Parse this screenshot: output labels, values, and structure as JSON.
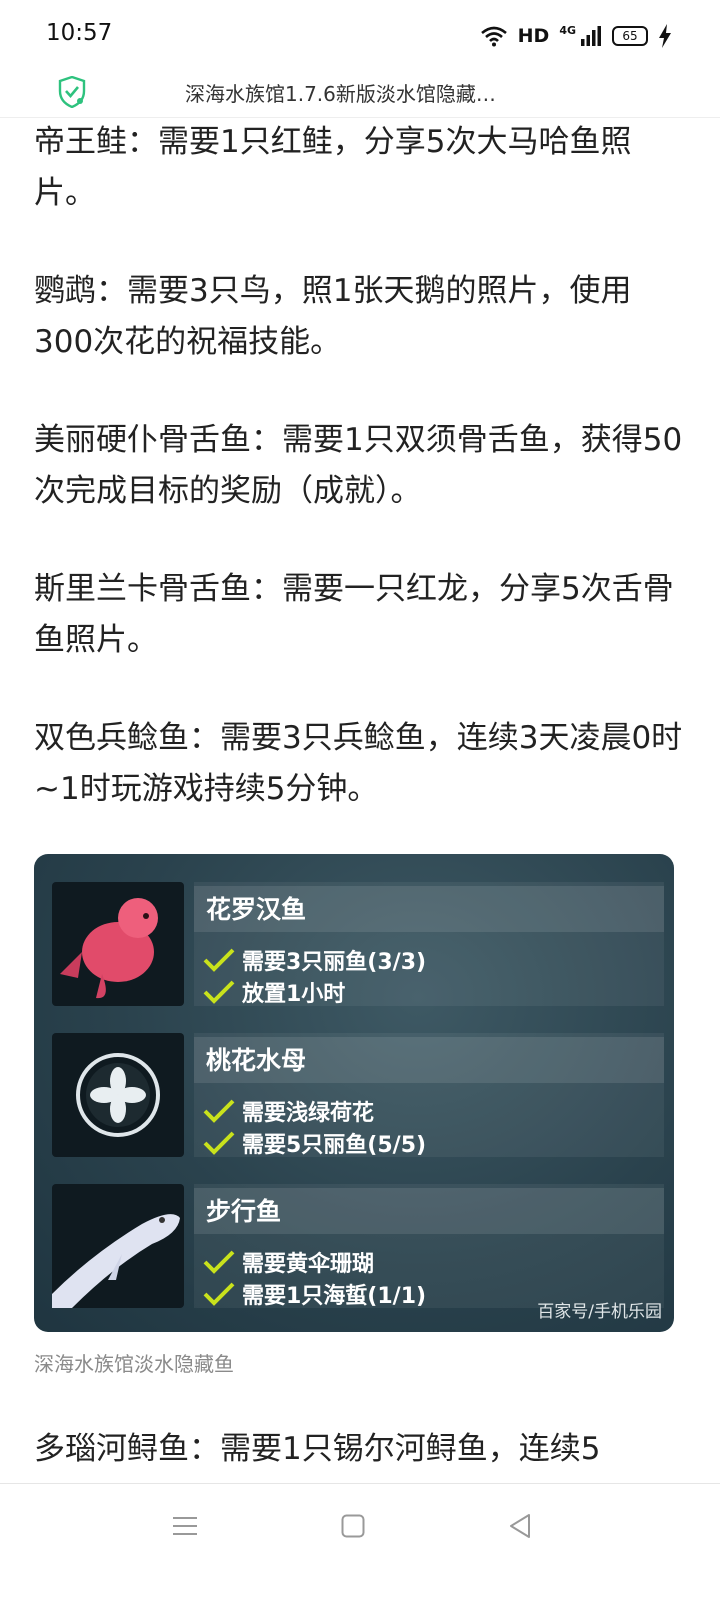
{
  "status": {
    "time": "10:57",
    "network": "HD",
    "signal_type": "4G",
    "battery": "65"
  },
  "header": {
    "title": "深海水族馆1.7.6新版淡水馆隐藏…"
  },
  "paragraphs": [
    "帝王鲑：需要1只红鲑，分享5次大马哈鱼照片。",
    "鹦鹉：需要3只鸟，照1张天鹅的照片，使用300次花的祝福技能。",
    "美丽硬仆骨舌鱼：需要1只双须骨舌鱼，获得50次完成目标的奖励（成就）。",
    "斯里兰卡骨舌鱼：需要一只红龙，分享5次舌骨鱼照片。",
    "双色兵鲶鱼：需要3只兵鲶鱼，连续3天凌晨0时~1时玩游戏持续5分钟。"
  ],
  "figure": {
    "items": [
      {
        "name": "花罗汉鱼",
        "reqs": [
          "需要3只丽鱼(3/3)",
          "放置1小时"
        ]
      },
      {
        "name": "桃花水母",
        "reqs": [
          "需要浅绿荷花",
          "需要5只丽鱼(5/5)"
        ]
      },
      {
        "name": "步行鱼",
        "reqs": [
          "需要黄伞珊瑚",
          "需要1只海蜇(1/1)"
        ]
      }
    ],
    "watermark": "百家号/手机乐园",
    "caption": "深海水族馆淡水隐藏鱼"
  },
  "last_paragraph": "多瑙河鲟鱼：需要1只锡尔河鲟鱼，连续5",
  "colors": {
    "check": "#c9e21c",
    "figure_bg": "#2a424d",
    "shield": "#2ec27e"
  }
}
